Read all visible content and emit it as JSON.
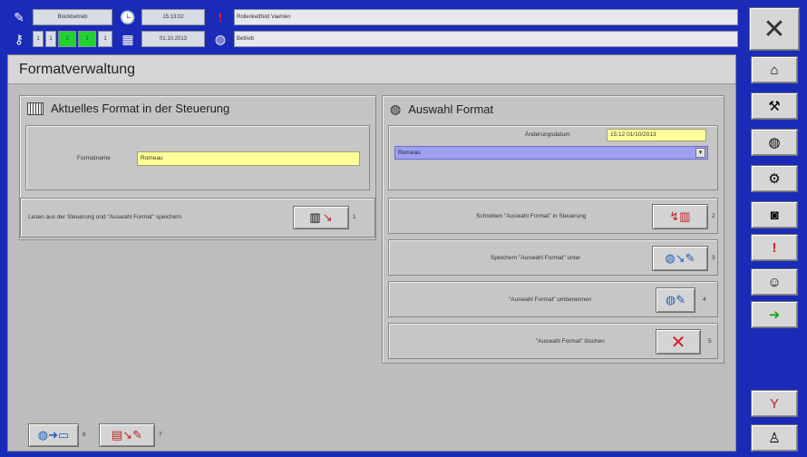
{
  "status": {
    "mode": "Blockbetrieb",
    "time": "15:13:02",
    "date": "01.10.2013",
    "alarm_message": "Rollenkettfeld Vaehlen",
    "info_message": "Betrieb",
    "indicator_values": [
      "1",
      "1",
      "1",
      "1",
      "1"
    ]
  },
  "page": {
    "title": "Formatverwaltung"
  },
  "left_panel": {
    "header": "Aktuelles Format in der Steuerung",
    "format_label": "Formatname",
    "format_value": "Romeau",
    "read_label": "Lesen aus der Steuerung und \"Auswahl Format\" speichern",
    "read_index": "1"
  },
  "right_panel": {
    "header": "Auswahl Format",
    "change_date_label": "Änderungsdatum",
    "change_date_value": "15:12 01/10/2013",
    "select_value": "Romeau",
    "actions": [
      {
        "label": "Schreiben \"Auswahl Format\" in Steuerung",
        "index": "2",
        "icon": "write-to-plc-icon"
      },
      {
        "label": "Speichern \"Auswahl Format\" unter",
        "index": "3",
        "icon": "save-as-icon"
      },
      {
        "label": "\"Auswahl Format\" umbenennen",
        "index": "4",
        "icon": "rename-icon"
      },
      {
        "label": "\"Auswahl Format\" löschen",
        "index": "5",
        "icon": "delete-icon"
      }
    ]
  },
  "bottom": {
    "buttons": [
      {
        "index": "6",
        "icon": "export-icon"
      },
      {
        "index": "7",
        "icon": "usb-import-icon"
      }
    ]
  },
  "sidebar": {
    "buttons": [
      "close-x-icon",
      "home-icon",
      "tools-icon",
      "globe-icon",
      "settings-icon",
      "binoculars-icon",
      "alarm-icon",
      "user-icon",
      "arrow-globe-icon",
      "warning-antenna-icon",
      "user-login-icon"
    ]
  },
  "colors": {
    "frame": "#1a2bb8",
    "field_yellow": "#ffff99",
    "select_blue": "#9f9ff0",
    "green": "#22d030"
  }
}
